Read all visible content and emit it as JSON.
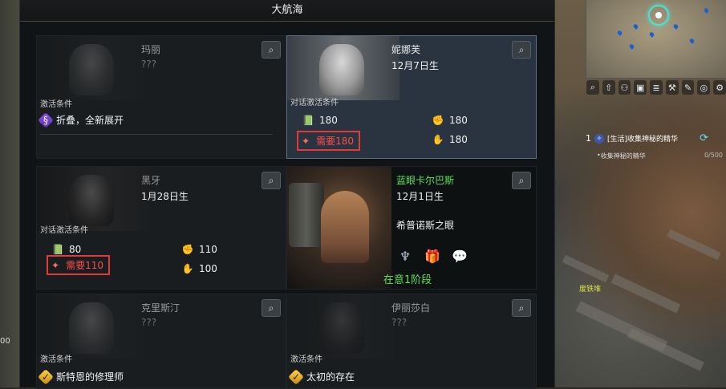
{
  "panel": {
    "title": "大航海"
  },
  "cards": [
    {
      "name": "玛丽",
      "sub": "???",
      "condition_label": "激活条件",
      "condition": {
        "icon": "purple-diamond-icon",
        "text": "折叠，全新展开"
      }
    },
    {
      "name": "妮娜芙",
      "sub": "12月7日生",
      "condition_label": "对话激活条件",
      "stats": [
        {
          "icon": "affinity-book-icon",
          "value": "180"
        },
        {
          "icon": "affinity-fist-icon",
          "value": "180"
        },
        {
          "icon": "affinity-hand-icon",
          "value": "180"
        }
      ],
      "need": "需要180"
    },
    {
      "name": "黑牙",
      "sub": "1月28日生",
      "condition_label": "对话激活条件",
      "stats": [
        {
          "icon": "affinity-book-icon",
          "value": "80"
        },
        {
          "icon": "affinity-fist-icon",
          "value": "110"
        },
        {
          "icon": "affinity-hand-icon",
          "value": "100"
        }
      ],
      "need": "需要110"
    },
    {
      "name": "蓝眼卡尔巴斯",
      "sub": "12月1日生",
      "title": "希普诺斯之眼",
      "status": "在意1阶段"
    },
    {
      "name": "克里斯汀",
      "sub": "???",
      "condition_label": "激活条件",
      "condition": {
        "icon": "gold-diamond-icon",
        "text": "斯特恩的修理师"
      }
    },
    {
      "name": "伊丽莎白",
      "sub": "???",
      "condition_label": "激活条件",
      "condition": {
        "icon": "gold-diamond-icon",
        "text": "太初的存在"
      }
    }
  ],
  "quest": {
    "num": "1",
    "title": "[生活]收集神秘的精华",
    "sub": "收集神秘的精华",
    "progress": "0/500"
  },
  "world": {
    "scrap_label": "废铁堆",
    "left_number": "00"
  }
}
